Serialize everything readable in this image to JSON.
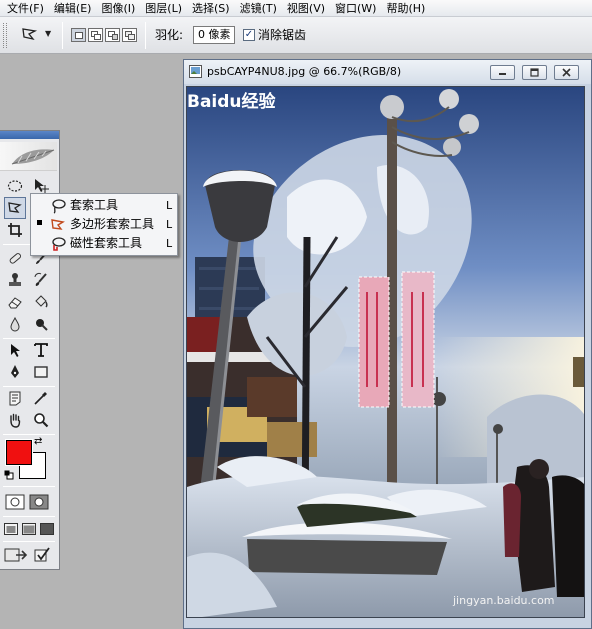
{
  "menu": [
    "文件(F)",
    "编辑(E)",
    "图像(I)",
    "图层(L)",
    "选择(S)",
    "滤镜(T)",
    "视图(V)",
    "窗口(W)",
    "帮助(H)"
  ],
  "options_bar": {
    "feather_label": "羽化:",
    "feather_value": "0 像素",
    "antialias_label": "消除锯齿",
    "antialias_checked": true
  },
  "toolbox": {
    "foreground_color": "#f01010",
    "background_color": "#ffffff",
    "icons": [
      "marquee-icon",
      "move-icon",
      "polygonal-lasso-icon",
      "crop-icon",
      "slice-icon",
      "healing-brush-icon",
      "brush-icon",
      "clone-stamp-icon",
      "history-brush-icon",
      "eraser-icon",
      "paint-bucket-icon",
      "blur-icon",
      "burn-icon",
      "path-selection-icon",
      "type-icon",
      "pen-icon",
      "shape-icon",
      "notes-icon",
      "eyedropper-icon",
      "hand-icon",
      "zoom-icon"
    ]
  },
  "lasso_flyout": {
    "items": [
      {
        "label": "套索工具",
        "key": "L",
        "icon": "lasso-icon",
        "selected": false
      },
      {
        "label": "多边形套索工具",
        "key": "L",
        "icon": "polygonal-lasso-icon",
        "selected": true
      },
      {
        "label": "磁性套索工具",
        "key": "L",
        "icon": "magnetic-lasso-icon",
        "selected": false
      }
    ]
  },
  "document": {
    "title": "psbCAYP4NU8.jpg @ 66.7%(RGB/8)",
    "watermark_url": "jingyan.baidu.com",
    "watermark_logo": "Baidu经验"
  }
}
